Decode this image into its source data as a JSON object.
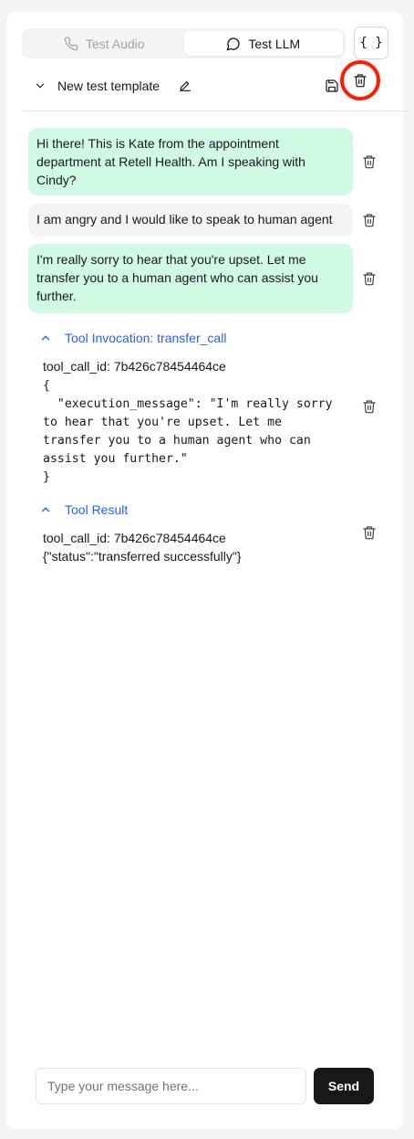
{
  "tabs": [
    {
      "label": "Test Audio",
      "icon": "phone-icon",
      "active": false
    },
    {
      "label": "Test LLM",
      "icon": "chat-bubble-icon",
      "active": true
    }
  ],
  "json_button": {
    "label": "{ }"
  },
  "template": {
    "name": "New test template"
  },
  "messages": [
    {
      "role": "agent",
      "text": "Hi there! This is Kate from the appointment department at Retell Health. Am I speaking with Cindy?"
    },
    {
      "role": "user",
      "text": "I am angry and I would like to speak to human agent"
    },
    {
      "role": "agent",
      "text": "I'm really sorry to hear that you're upset. Let me transfer you to a human agent who can assist you further."
    }
  ],
  "tool_invocation": {
    "header": "Tool Invocation: transfer_call",
    "tool_call_id": "tool_call_id: 7b426c78454464ce",
    "arguments": "{\n  \"execution_message\": \"I'm really sorry\nto hear that you're upset. Let me\ntransfer you to a human agent who can\nassist you further.\"\n}"
  },
  "tool_result": {
    "header": "Tool Result",
    "tool_call_id": "tool_call_id: 7b426c78454464ce",
    "result": "{\"status\":\"transferred successfully\"}"
  },
  "composer": {
    "placeholder": "Type your message here...",
    "send_label": "Send"
  },
  "colors": {
    "agent_bubble": "#d1fae5",
    "user_bubble": "#f4f4f5",
    "tool_header": "#2563eb",
    "highlight_circle": "#ff1a00",
    "send_button": "#18181b"
  }
}
